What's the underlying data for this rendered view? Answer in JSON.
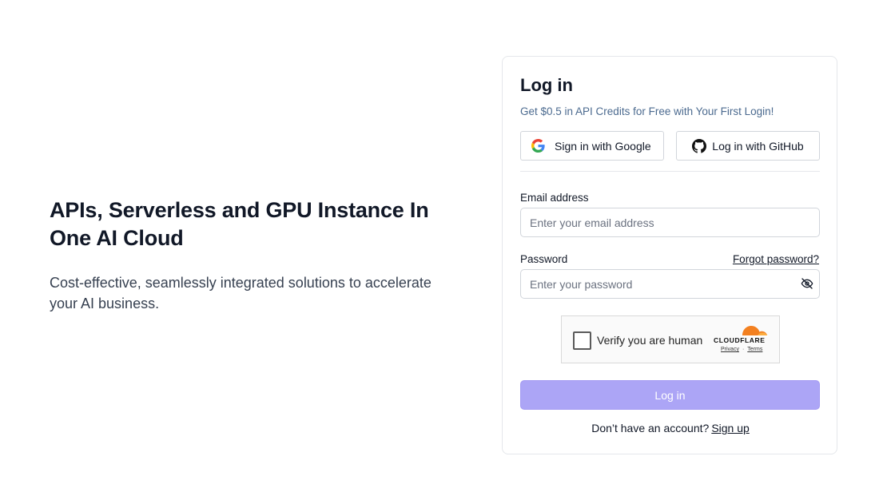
{
  "hero": {
    "title": "APIs, Serverless and GPU Instance In One AI Cloud",
    "subtitle": "Cost-effective, seamlessly integrated solutions to accelerate your AI business."
  },
  "login": {
    "title": "Log in",
    "promo": "Get $0.5 in API Credits for Free with Your First Login!",
    "google_button": "Sign in with Google",
    "github_button": "Log in with GitHub",
    "email_label": "Email address",
    "email_placeholder": "Enter your email address",
    "password_label": "Password",
    "forgot_password": "Forgot password?",
    "password_placeholder": "Enter your password",
    "submit_label": "Log in",
    "signup_prompt": "Don’t have an account?",
    "signup_link": "Sign up"
  },
  "captcha": {
    "label": "Verify you are human",
    "brand": "CLOUDFLARE",
    "privacy": "Privacy",
    "separator": "·",
    "terms": "Terms"
  },
  "colors": {
    "accent_button": "#aca5f6",
    "promo_text": "#4b6a8f",
    "cloudflare_orange": "#f38020"
  },
  "icons": [
    "google-icon",
    "github-icon",
    "eye-off-icon",
    "cloudflare-logo"
  ]
}
